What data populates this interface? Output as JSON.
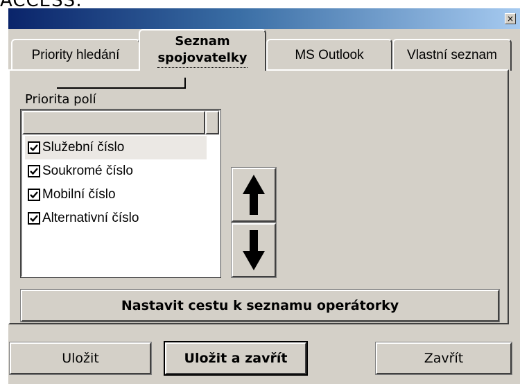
{
  "caption": "ACCESS:",
  "window": {
    "close_glyph": "×"
  },
  "tabs": [
    {
      "label": "Priority hledání"
    },
    {
      "label_line1": "Seznam",
      "label_line2": "spojovatelky",
      "active": true
    },
    {
      "label": "MS Outlook"
    },
    {
      "label": "Vlastní seznam"
    }
  ],
  "section_label": "Priorita polí",
  "fields": [
    {
      "label": "Služební číslo",
      "checked": true,
      "selected": true
    },
    {
      "label": "Soukromé číslo",
      "checked": true
    },
    {
      "label": "Mobilní číslo",
      "checked": true
    },
    {
      "label": "Alternativní číslo",
      "checked": true
    }
  ],
  "move_buttons": {
    "up_icon": "arrow-up-icon",
    "down_icon": "arrow-down-icon"
  },
  "set_path_button": "Nastavit cestu k seznamu operátorky",
  "footer": {
    "save": "Uložit",
    "save_close": "Uložit a zavřít",
    "close": "Zavřít"
  }
}
